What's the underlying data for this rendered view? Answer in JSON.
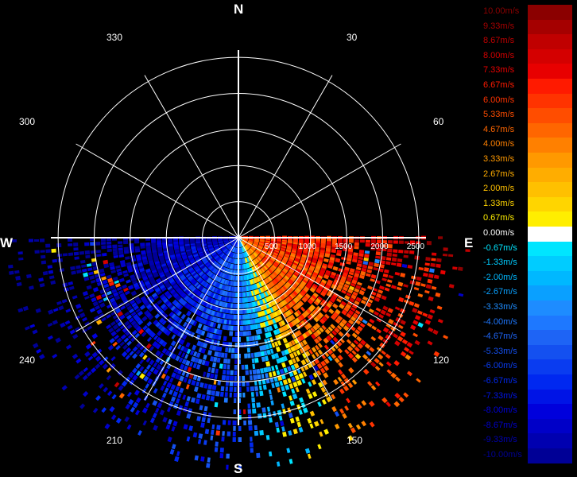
{
  "compass": {
    "north": "N",
    "east": "E",
    "south": "S",
    "west": "W"
  },
  "azimuth_labels": [
    "30",
    "60",
    "120",
    "150",
    "210",
    "240",
    "300",
    "330"
  ],
  "chart_data": {
    "type": "polar",
    "angular_axis": {
      "direction": "clockwise",
      "zero": "north",
      "tick_labels": [
        "30",
        "60",
        "120",
        "150",
        "210",
        "240",
        "300",
        "330"
      ]
    },
    "radial_axis": {
      "tick_labels": [
        "500",
        "1000",
        "1500",
        "2000",
        "2500"
      ],
      "range": [
        0,
        2600
      ]
    },
    "legend_unit": "m/s",
    "colorbar": [
      {
        "label": "10.00m/s",
        "color": "#8b0000"
      },
      {
        "label": "9.33m/s",
        "color": "#a50000"
      },
      {
        "label": "8.67m/s",
        "color": "#c00000"
      },
      {
        "label": "8.00m/s",
        "color": "#d40000"
      },
      {
        "label": "7.33m/s",
        "color": "#e80000"
      },
      {
        "label": "6.67m/s",
        "color": "#ff1a00"
      },
      {
        "label": "6.00m/s",
        "color": "#ff3300"
      },
      {
        "label": "5.33m/s",
        "color": "#ff4d00"
      },
      {
        "label": "4.67m/s",
        "color": "#ff6600"
      },
      {
        "label": "4.00m/s",
        "color": "#ff8000"
      },
      {
        "label": "3.33m/s",
        "color": "#ff9900"
      },
      {
        "label": "2.67m/s",
        "color": "#ffad00"
      },
      {
        "label": "2.00m/s",
        "color": "#ffc000"
      },
      {
        "label": "1.33m/s",
        "color": "#ffd500"
      },
      {
        "label": "0.67m/s",
        "color": "#ffee00"
      },
      {
        "label": "0.00m/s",
        "color": "#ffffff"
      },
      {
        "label": "-0.67m/s",
        "color": "#00e5ff"
      },
      {
        "label": "-1.33m/s",
        "color": "#00ccff"
      },
      {
        "label": "-2.00m/s",
        "color": "#00b8ff"
      },
      {
        "label": "-2.67m/s",
        "color": "#0aa0ff"
      },
      {
        "label": "-3.33m/s",
        "color": "#1e8cff"
      },
      {
        "label": "-4.00m/s",
        "color": "#1e78ff"
      },
      {
        "label": "-4.67m/s",
        "color": "#1e64f5"
      },
      {
        "label": "-5.33m/s",
        "color": "#1450f0"
      },
      {
        "label": "-6.00m/s",
        "color": "#0a3cf0"
      },
      {
        "label": "-6.67m/s",
        "color": "#0028f0"
      },
      {
        "label": "-7.33m/s",
        "color": "#0014e6"
      },
      {
        "label": "-8.00m/s",
        "color": "#0000dc"
      },
      {
        "label": "-8.67m/s",
        "color": "#0000c8"
      },
      {
        "label": "-9.33m/s",
        "color": "#0000b0"
      },
      {
        "label": "-10.00m/s",
        "color": "#000096"
      }
    ]
  }
}
